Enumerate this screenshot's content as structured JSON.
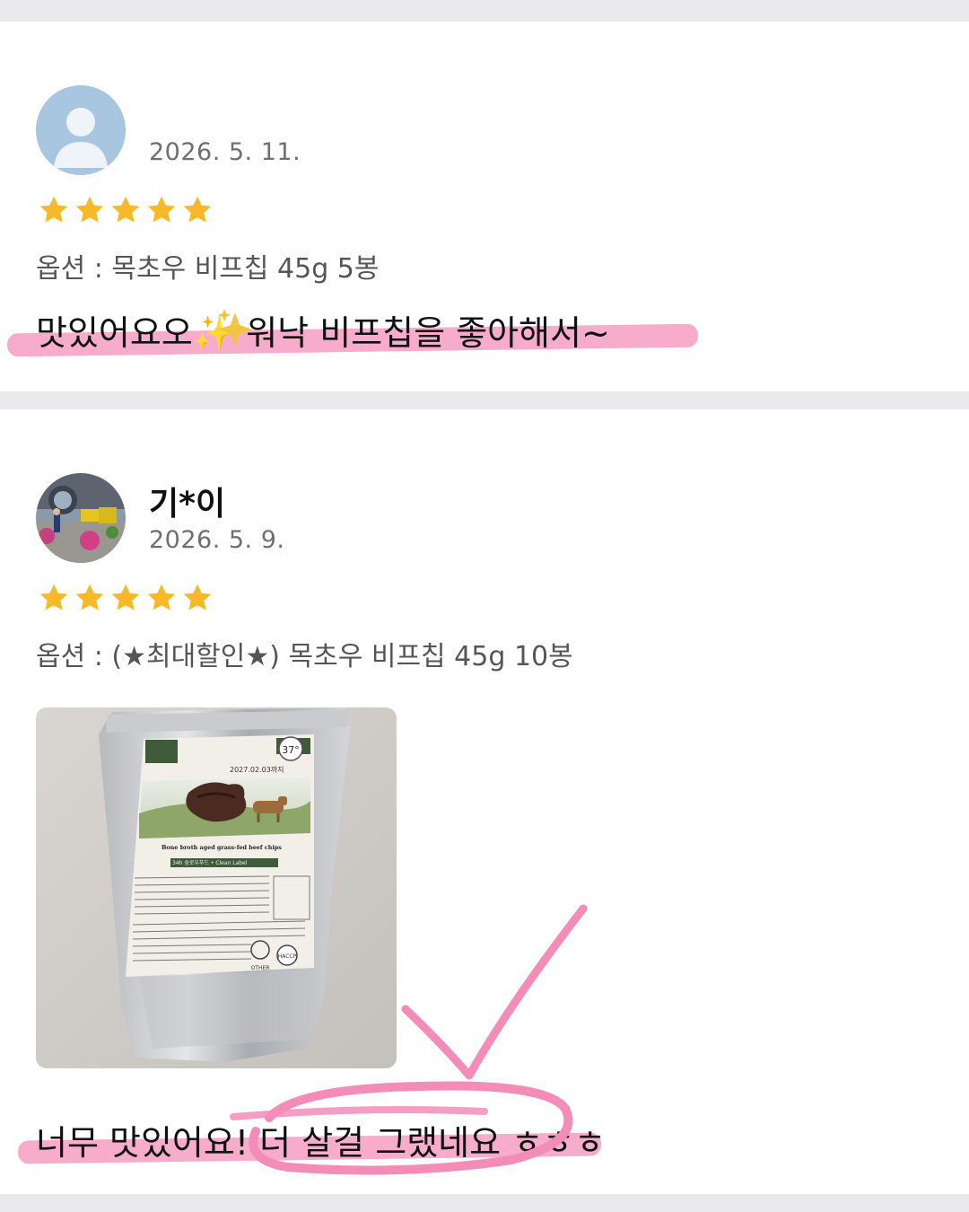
{
  "reviews": [
    {
      "author": "",
      "date": "2026. 5. 11.",
      "rating": 5,
      "option": "옵션 : 목초우 비프칩 45g 5봉",
      "text": "맛있어요오✨ 워낙 비프칩을 좋아해서~"
    },
    {
      "author": "기*이",
      "date": "2026. 5. 9.",
      "rating": 5,
      "option": "옵션 : (★최대할인★) 목초우 비프칩 45g 10봉",
      "text": "너무 맛있어요! 더 살걸 그랬네요 ㅎㅎㅎ",
      "photo": {
        "stamp": "37°",
        "date_print": "2027.02.03까지",
        "product_line": "Bone broth aged grass-fed beef chips",
        "tagline": "34h 숨로우푸드 • Clean Label",
        "recycle": "OTHER",
        "cert": "HACCP"
      }
    }
  ],
  "colors": {
    "star": "#f7b928",
    "highlight": "#f48cb8",
    "divider": "#e9e9eb",
    "avatar_default": "#a9c6e0"
  },
  "icons": [
    "default-avatar-icon",
    "star-icon",
    "sparkle-icon",
    "recycle-icon",
    "checkmark-doodle"
  ]
}
